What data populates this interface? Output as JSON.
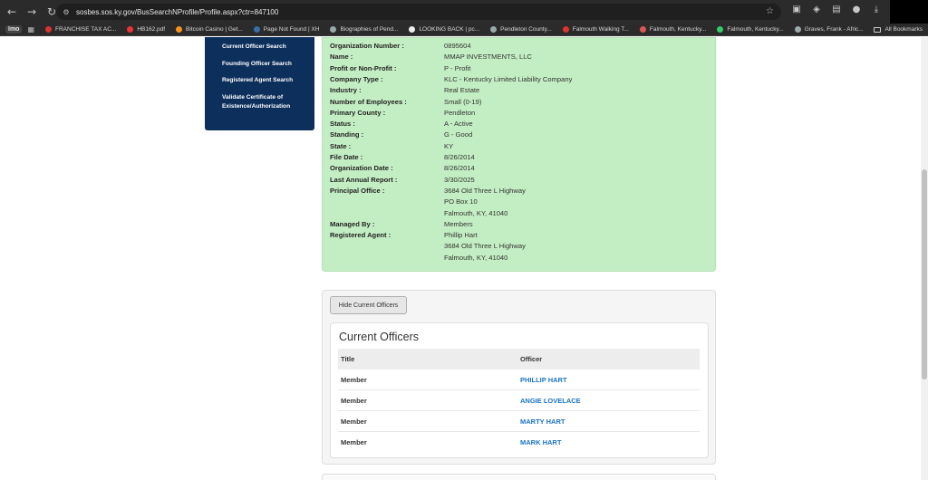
{
  "browser": {
    "url": "sosbes.sos.ky.gov/BusSearchNProfile/Profile.aspx?ctr=847100"
  },
  "bookmarks": {
    "apps_label": "Imo",
    "items": [
      {
        "label": "FRANCHISE TAX AC...",
        "color": "#d33"
      },
      {
        "label": "HB162.pdf",
        "color": "#e33"
      },
      {
        "label": "Bitcoin Casino | Get...",
        "color": "#f7931a"
      },
      {
        "label": "Page Not Found | XH",
        "color": "#3a6ea5"
      },
      {
        "label": "Biographies of Pend...",
        "color": "#9aa"
      },
      {
        "label": "LOOKING BACK | pc...",
        "color": "#eee"
      },
      {
        "label": "Pendleton County...",
        "color": "#9aa"
      },
      {
        "label": "Falmouth Walking T...",
        "color": "#d33"
      },
      {
        "label": "Falmouth, Kentucky...",
        "color": "#d55"
      },
      {
        "label": "Falmouth, Kentucky...",
        "color": "#3c6"
      },
      {
        "label": "Graves, Frank - Afric...",
        "color": "#9aa"
      }
    ],
    "all_label": "All Bookmarks"
  },
  "sidenav": {
    "links": [
      "Current Officer Search",
      "Founding Officer Search",
      "Registered Agent Search",
      "Validate Certificate of",
      "Existence/Authorization"
    ]
  },
  "profile": [
    {
      "label": "Organization Number :",
      "value": "0895604"
    },
    {
      "label": "Name :",
      "value": "MMAP INVESTMENTS, LLC"
    },
    {
      "label": "Profit or Non-Profit :",
      "value": "P - Profit"
    },
    {
      "label": "Company Type :",
      "value": "KLC - Kentucky Limited Liability Company"
    },
    {
      "label": "Industry :",
      "value": "Real Estate"
    },
    {
      "label": "Number of Employees :",
      "value": "Small (0-19)"
    },
    {
      "label": "Primary County :",
      "value": "Pendleton"
    },
    {
      "label": "Status :",
      "value": "A - Active"
    },
    {
      "label": "Standing :",
      "value": "G - Good"
    },
    {
      "label": "State :",
      "value": "KY"
    },
    {
      "label": "File Date :",
      "value": "8/26/2014"
    },
    {
      "label": "Organization Date :",
      "value": "8/26/2014"
    },
    {
      "label": "Last Annual Report :",
      "value": "3/30/2025"
    },
    {
      "label": "Principal Office :",
      "value": "3684 Old Three L Highway"
    },
    {
      "label": "",
      "value": "PO Box 10"
    },
    {
      "label": "",
      "value": "Falmouth, KY, 41040"
    },
    {
      "label": "Managed By :",
      "value": "Members"
    },
    {
      "label": "Registered Agent :",
      "value": "Phillip Hart"
    },
    {
      "label": "",
      "value": "3684 Old Three L Highway"
    },
    {
      "label": "",
      "value": "Falmouth, KY, 41040"
    }
  ],
  "officers": {
    "toggle_label": "Hide Current Officers",
    "heading": "Current Officers",
    "columns": {
      "title": "Title",
      "officer": "Officer"
    },
    "rows": [
      {
        "title": "Member",
        "officer": "PHILLIP HART"
      },
      {
        "title": "Member",
        "officer": "ANGIE LOVELACE"
      },
      {
        "title": "Member",
        "officer": "MARTY HART"
      },
      {
        "title": "Member",
        "officer": "MARK HART"
      }
    ]
  }
}
